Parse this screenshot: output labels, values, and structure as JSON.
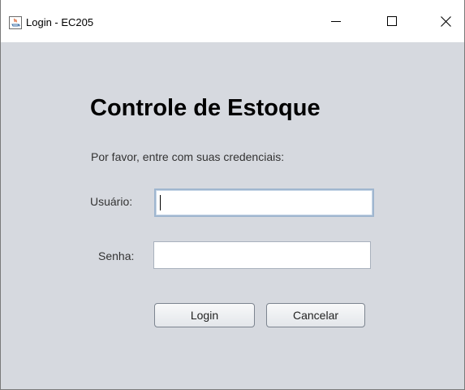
{
  "window": {
    "title": "Login - EC205",
    "controls": {
      "minimize": "minimize",
      "maximize": "maximize",
      "close": "close"
    }
  },
  "form": {
    "heading": "Controle de Estoque",
    "subtitle": "Por favor, entre com suas credenciais:",
    "username_label": "Usuário:",
    "username_value": "",
    "password_label": "Senha:",
    "password_value": "",
    "login_button": "Login",
    "cancel_button": "Cancelar"
  },
  "colors": {
    "panel_background": "#d6d9df",
    "titlebar_background": "#ffffff",
    "focused_field_border": "#9fb6cf"
  },
  "icons": {
    "app_icon": "java-cup-icon"
  }
}
